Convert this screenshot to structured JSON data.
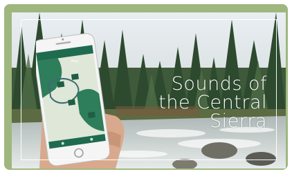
{
  "image": {
    "title_line1": "Sounds of",
    "title_line2": "the Central",
    "title_line3": "Sierra",
    "phone_screen_title": "Map"
  },
  "colors": {
    "card_background": "#9fb77f",
    "app_header": "#1f6b4f",
    "map_background": "#dfe7d8"
  },
  "icons": [
    "map-marker-icon",
    "home-icon",
    "list-icon"
  ]
}
